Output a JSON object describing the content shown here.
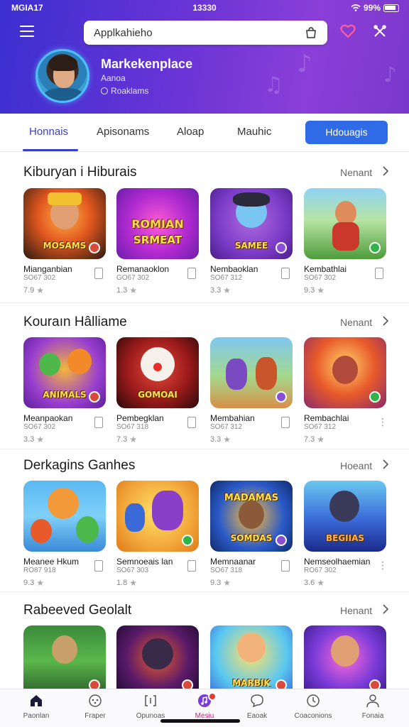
{
  "status_bar": {
    "left": "MGIA17",
    "time": "13330",
    "battery": "99%"
  },
  "header": {
    "search_value": "Applkahieho",
    "profile_name": "Markekenplace",
    "profile_sub": "Aanoa",
    "profile_meta": "Roaklams"
  },
  "tabs": [
    {
      "label": "Honnais"
    },
    {
      "label": "Apisonams"
    },
    {
      "label": "Aloap"
    },
    {
      "label": "Mauhic"
    }
  ],
  "tab_button": "Hdouagis",
  "sections": [
    {
      "title": "Kiburyan i Hiburais",
      "more": "Nenant",
      "cards": [
        {
          "name": "Mianganbian",
          "code": "SO67 302",
          "rating": "7.9",
          "thumb_text": "MOSAMS",
          "action": "doc"
        },
        {
          "name": "Remanaoklon",
          "code": "GO67 302",
          "rating": "1.3",
          "thumb_text": "SRMEAT",
          "action": "doc"
        },
        {
          "name": "Nembaoklan",
          "code": "SO67 312",
          "rating": "3.3",
          "thumb_text": "SAMEE",
          "action": "doc"
        },
        {
          "name": "Kembathlai",
          "code": "SO67 302",
          "rating": "9.3",
          "thumb_text": "",
          "action": "doc"
        }
      ]
    },
    {
      "title": "Kouraın Hâlliame",
      "more": "Nenant",
      "cards": [
        {
          "name": "Meanpaokan",
          "code": "SO67 302",
          "rating": "3.3",
          "thumb_text": "ANIMALS",
          "action": "doc"
        },
        {
          "name": "Pembegklan",
          "code": "SO67 318",
          "rating": "7.3",
          "thumb_text": "GOMOAI",
          "action": "doc"
        },
        {
          "name": "Membahian",
          "code": "SO67 312",
          "rating": "3.3",
          "thumb_text": "",
          "action": "doc"
        },
        {
          "name": "Rembachlai",
          "code": "SO67 312",
          "rating": "7.3",
          "thumb_text": "",
          "action": "more"
        }
      ]
    },
    {
      "title": "Derkagins Ganhes",
      "more": "Hoeant",
      "cards": [
        {
          "name": "Meanee Hkum",
          "code": "RO87 918",
          "rating": "9.3",
          "thumb_text": "",
          "action": "doc"
        },
        {
          "name": "Semnoeais lan",
          "code": "SO67 303",
          "rating": "1.8",
          "thumb_text": "",
          "action": "doc"
        },
        {
          "name": "Memnaanar",
          "code": "SO67 318",
          "rating": "9.3",
          "thumb_text": "SOMDAS",
          "action": "doc"
        },
        {
          "name": "Nemseolhaemian",
          "code": "RO67 302",
          "rating": "3.6",
          "thumb_text": "BEGIIAS",
          "action": "more"
        }
      ]
    },
    {
      "title": "Rabeeved Geolalt",
      "more": "Henant",
      "cards": [
        {
          "name": "",
          "code": "",
          "rating": "",
          "thumb_text": "",
          "action": "none"
        },
        {
          "name": "",
          "code": "",
          "rating": "",
          "thumb_text": "",
          "action": "none"
        },
        {
          "name": "",
          "code": "",
          "rating": "",
          "thumb_text": "MARBIK",
          "action": "none"
        },
        {
          "name": "",
          "code": "",
          "rating": "",
          "thumb_text": "",
          "action": "none"
        }
      ]
    }
  ],
  "bottom_nav": [
    {
      "label": "Paonlan",
      "icon": "home-icon"
    },
    {
      "label": "Fraper",
      "icon": "gamepad-icon"
    },
    {
      "label": "Opunoas",
      "icon": "bracket-icon"
    },
    {
      "label": "Mesiu",
      "icon": "music-icon"
    },
    {
      "label": "Eaoak",
      "icon": "chat-icon"
    },
    {
      "label": "Coaconions",
      "icon": "clock-icon"
    },
    {
      "label": "Fonaia",
      "icon": "person-icon"
    }
  ],
  "colors": {
    "header_start": "#3b2fd0",
    "header_end": "#8b3fd8",
    "accent": "#3a3fc4",
    "tab_button": "#2f6be6",
    "nav_active": "#c0257a"
  }
}
